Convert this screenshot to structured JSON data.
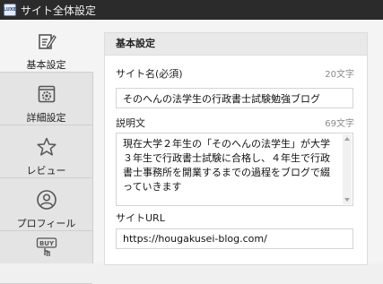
{
  "window": {
    "title": "サイト全体設定",
    "app_icon_text": "LUXE"
  },
  "sidebar": {
    "items": [
      {
        "label": "基本設定",
        "icon": "edit-icon",
        "active": true
      },
      {
        "label": "詳細設定",
        "icon": "gear-window-icon",
        "active": false
      },
      {
        "label": "レビュー",
        "icon": "star-icon",
        "active": false
      },
      {
        "label": "プロフィール",
        "icon": "person-icon",
        "active": false
      },
      {
        "label": "",
        "icon": "buy-hand-icon",
        "active": false
      }
    ]
  },
  "panel": {
    "title": "基本設定",
    "site_name": {
      "label": "サイト名(必須)",
      "count": "20文字",
      "value": "そのへんの法学生の行政書士試験勉強ブログ"
    },
    "description": {
      "label": "説明文",
      "count": "69文字",
      "value": "現在大学２年生の「そのへんの法学生」が大学３年生で行政書士試験に合格し、４年生で行政書士事務所を開業するまでの過程をブログで綴っていきます"
    },
    "site_url": {
      "label": "サイトURL",
      "value": "https://hougakusei-blog.com/"
    }
  },
  "colors": {
    "titlebar": "#2b2b2b",
    "sidebar": "#e4e4e4",
    "panel_header": "#e9e9e9"
  }
}
